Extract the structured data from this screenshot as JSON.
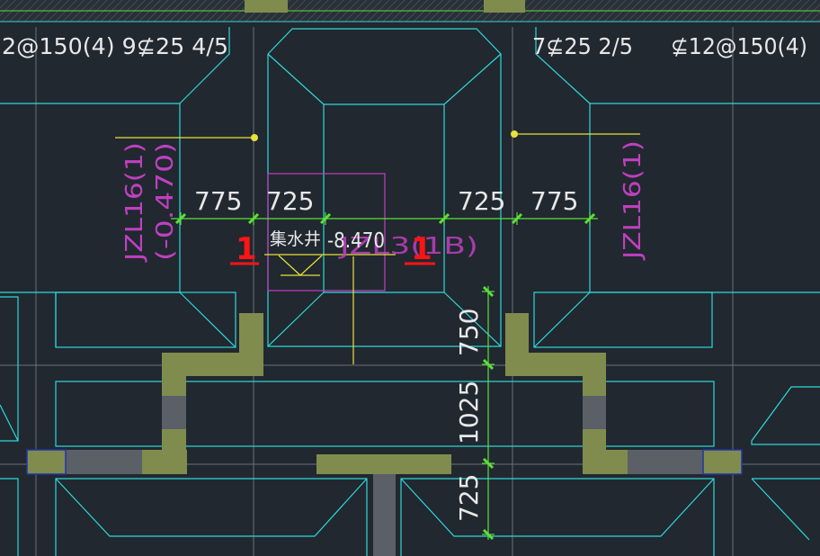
{
  "labels": {
    "rebar_left": "2@150(4)  9⊈25 4/5",
    "rebar_mid": "7⊈25 2/5",
    "rebar_right": "⊈12@150(4)",
    "dim_775_left": "775",
    "dim_725_left": "725",
    "dim_725_right": "725",
    "dim_775_right": "775",
    "beam_left": "JZL16(1)",
    "beam_left_elev": "(-0.470)",
    "beam_right": "JZL16(1)",
    "beam_mid_fragment": "JZL3(1B)",
    "sump_name": "集水井",
    "sump_elev": "-8.470",
    "section_mark_left": "1",
    "section_mark_right": "1",
    "dim_v_750": "750",
    "dim_v_1025": "1025",
    "dim_v_725": "725"
  },
  "colors": {
    "background": "#212830",
    "cyan": "#2fd8d8",
    "grid": "#6b7178",
    "wall_fill": "#7f8c4e",
    "wall_dark": "#5b5f66",
    "dim_green": "#5dde3a",
    "magenta": "#c040c0",
    "yellow": "#e8e23a",
    "red": "#ff1414",
    "white": "#e8e8e8",
    "blue_edge": "#2233aa"
  }
}
